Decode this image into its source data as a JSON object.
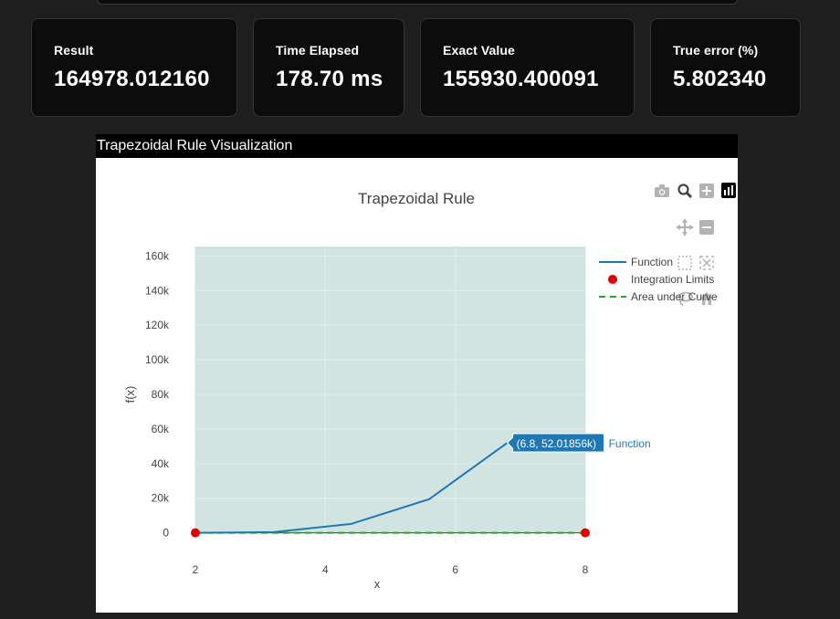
{
  "metrics": [
    {
      "label": "Result",
      "value": "164978.012160"
    },
    {
      "label": "Time Elapsed",
      "value": "178.70 ms"
    },
    {
      "label": "Exact Value",
      "value": "155930.400091"
    },
    {
      "label": "True error (%)",
      "value": "5.802340"
    }
  ],
  "panel": {
    "title": "Trapezoidal Rule Visualization"
  },
  "modebar": [
    "camera-icon",
    "zoom-icon",
    "zoom-in-icon",
    "plotly-logo-icon",
    "pan-icon",
    "zoom-out-icon",
    "box-select-icon",
    "autoscale-icon",
    "lasso-icon",
    "home-icon"
  ],
  "chart_data": {
    "type": "line",
    "title": "Trapezoidal Rule",
    "xlabel": "x",
    "ylabel": "f(x)",
    "xlim": [
      2,
      8
    ],
    "ylim": [
      -6000,
      166000
    ],
    "x_ticks": [
      2,
      4,
      6,
      8
    ],
    "x_tick_labels": [
      "2",
      "4",
      "6",
      "8"
    ],
    "y_ticks": [
      0,
      20000,
      40000,
      60000,
      80000,
      100000,
      120000,
      140000,
      160000
    ],
    "y_tick_labels": [
      "0",
      "20k",
      "40k",
      "60k",
      "80k",
      "100k",
      "120k",
      "140k",
      "160k"
    ],
    "grid": true,
    "legend_position": "top-right",
    "series": [
      {
        "name": "Function",
        "kind": "line",
        "color": "#1f77b4",
        "x": [
          2,
          3.2,
          4.4,
          5.6,
          6.8
        ],
        "y": [
          0,
          410,
          5180,
          19500,
          52018.56
        ]
      },
      {
        "name": "Integration Limits",
        "kind": "markers",
        "color": "#e00000",
        "x": [
          2,
          8
        ],
        "y": [
          0,
          0
        ]
      },
      {
        "name": "Area under Curve",
        "kind": "dash",
        "color": "#2ca02c",
        "x": [
          2,
          8
        ],
        "y": [
          0,
          0
        ],
        "fill_x": [
          2,
          8
        ],
        "fill_top": 165000,
        "fill_color": "#cfe3df"
      }
    ],
    "hover": {
      "text": "(6.8, 52.01856k)",
      "series": "Function",
      "x": 6.8,
      "y": 52018.56
    }
  }
}
